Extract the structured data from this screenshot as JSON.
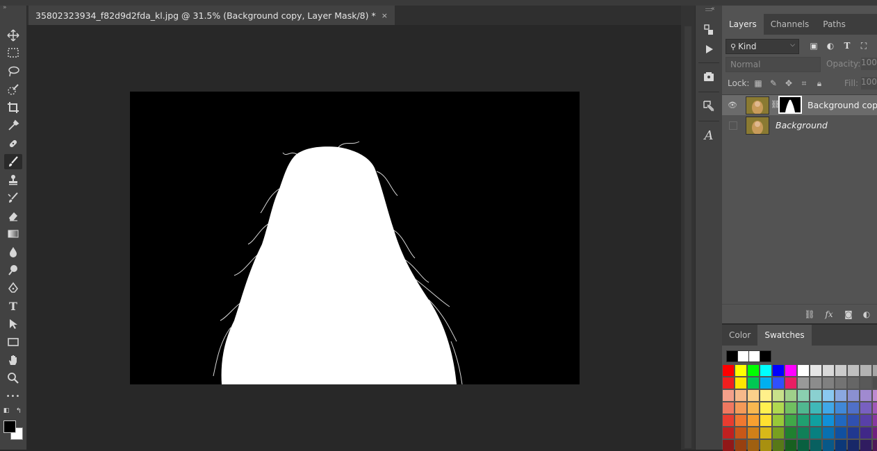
{
  "document_tab": {
    "title": "35802323934_f82d9d2fda_kl.jpg @ 31.5% (Background copy, Layer Mask/8) *",
    "close": "×"
  },
  "toolbar": {
    "tools": [
      "move-icon",
      "marquee-icon",
      "lasso-icon",
      "quick-select-icon",
      "crop-icon",
      "eyedropper-icon",
      "healing-brush-icon",
      "brush-icon",
      "clone-stamp-icon",
      "history-brush-icon",
      "eraser-icon",
      "gradient-icon",
      "blur-icon",
      "dodge-icon",
      "pen-icon",
      "type-icon",
      "path-selection-icon",
      "rectangle-icon",
      "hand-icon",
      "zoom-icon",
      "more-tools-icon"
    ],
    "type_tool_label": "T",
    "more_label": "•••",
    "active_tool": "brush-icon"
  },
  "dock": {
    "icons": [
      "history-icon",
      "actions-play-icon",
      "libraries-icon",
      "properties-icon",
      "character-icon"
    ]
  },
  "layers_panel": {
    "tabs": [
      "Layers",
      "Channels",
      "Paths"
    ],
    "active_tab": "Layers",
    "filter_kind": "Kind",
    "blend_mode": "Normal",
    "opacity_label": "Opacity:",
    "opacity_value": "100",
    "lock_label": "Lock:",
    "fill_label": "Fill:",
    "fill_value": "100",
    "layers": [
      {
        "name": "Background copy",
        "visible": true,
        "selected": true,
        "has_mask": true
      },
      {
        "name": "Background",
        "visible": false,
        "selected": false,
        "has_mask": false,
        "italic": true
      }
    ]
  },
  "color_panel": {
    "tabs": [
      "Color",
      "Swatches"
    ],
    "active_tab": "Swatches"
  },
  "colors": {
    "accent_selected_layer": "#6b6b6b",
    "panel_bg": "#535353",
    "mask_white": "#ffffff",
    "mask_black": "#000000"
  }
}
